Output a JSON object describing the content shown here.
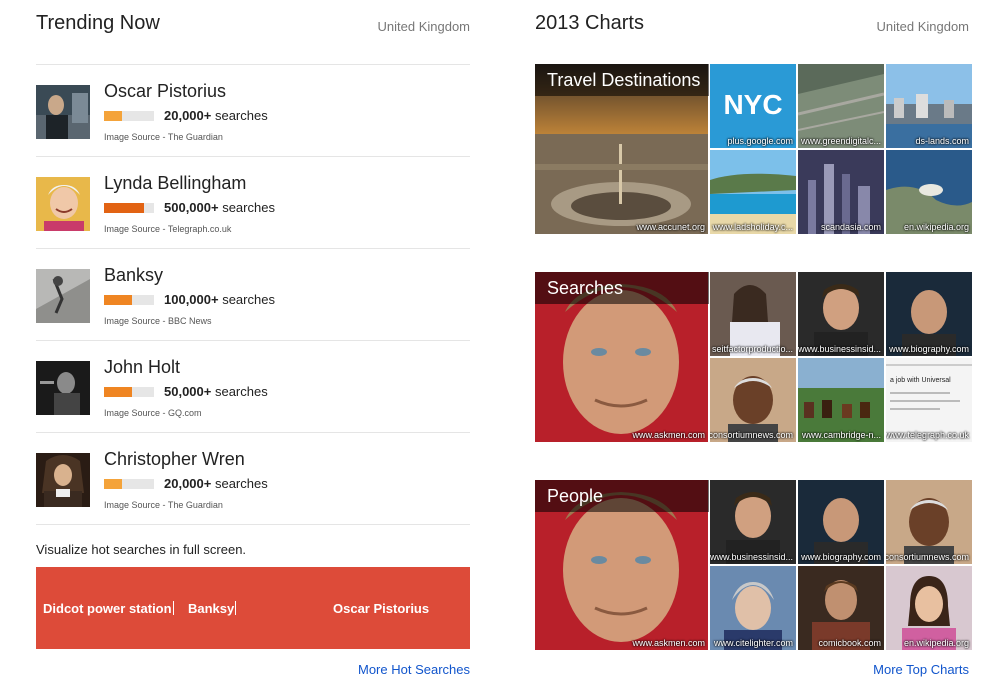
{
  "trending": {
    "title": "Trending Now",
    "region": "United Kingdom",
    "items": [
      {
        "name": "Oscar Pistorius",
        "count": "20,000+",
        "suffix": " searches",
        "source": "Image Source - The Guardian",
        "level": 0.35,
        "color": "#f4a33a"
      },
      {
        "name": "Lynda Bellingham",
        "count": "500,000+",
        "suffix": " searches",
        "source": "Image Source - Telegraph.co.uk",
        "level": 0.8,
        "color": "#e26313"
      },
      {
        "name": "Banksy",
        "count": "100,000+",
        "suffix": " searches",
        "source": "Image Source - BBC News",
        "level": 0.55,
        "color": "#ef8522"
      },
      {
        "name": "John Holt",
        "count": "50,000+",
        "suffix": " searches",
        "source": "Image Source - GQ.com",
        "level": 0.55,
        "color": "#ef8522"
      },
      {
        "name": "Christopher Wren",
        "count": "20,000+",
        "suffix": " searches",
        "source": "Image Source - The Guardian",
        "level": 0.35,
        "color": "#f4a33a"
      }
    ],
    "visualize_text": "Visualize hot searches in full screen.",
    "hot_searches": [
      "Didcot power station",
      "Banksy",
      "Oscar Pistorius"
    ],
    "more_link": "More Hot Searches"
  },
  "charts": {
    "title": "2013 Charts",
    "region": "United Kingdom",
    "more_link": "More Top Charts",
    "panels": [
      {
        "title": "Travel Destinations",
        "main_caption": "www.accunet.org",
        "captions": [
          "plus.google.com",
          "www.greendigitalc...",
          "ds-lands.com",
          "www.ladsholiday.c...",
          "scandasia.com",
          "en.wikipedia.org"
        ],
        "logo_text": "NYC"
      },
      {
        "title": "Searches",
        "main_caption": "www.askmen.com",
        "captions": [
          "seitfactorproductio...",
          "www.businessinsid...",
          "www.biography.com",
          "consortiumnews.com",
          "www.cambridge-n...",
          "www.telegraph.co.uk"
        ],
        "doc_text": "a job with Universal"
      },
      {
        "title": "People",
        "main_caption": "www.askmen.com",
        "captions": [
          "www.businessinsid...",
          "www.biography.com",
          "consortiumnews.com",
          "www.citelighter.com",
          "comicbook.com",
          "en.wikipedia.org"
        ]
      }
    ]
  }
}
